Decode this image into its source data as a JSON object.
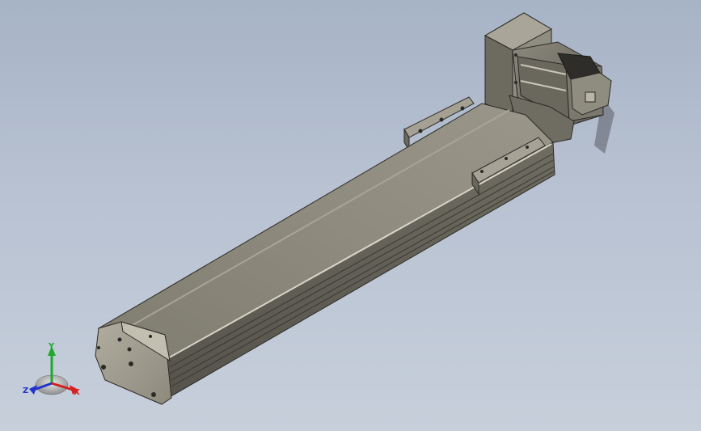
{
  "viewport": {
    "background_top": "#a7b3c6",
    "background_bottom": "#c7cfdb"
  },
  "model": {
    "body_color": "#8a877a",
    "dark_color": "#4e4c44",
    "edge_color": "#2b2a26"
  },
  "triad": {
    "x_label": "X",
    "y_label": "Y",
    "z_label": "Z",
    "x_color": "#d42020",
    "y_color": "#1fa82a",
    "z_color": "#2233cc"
  }
}
